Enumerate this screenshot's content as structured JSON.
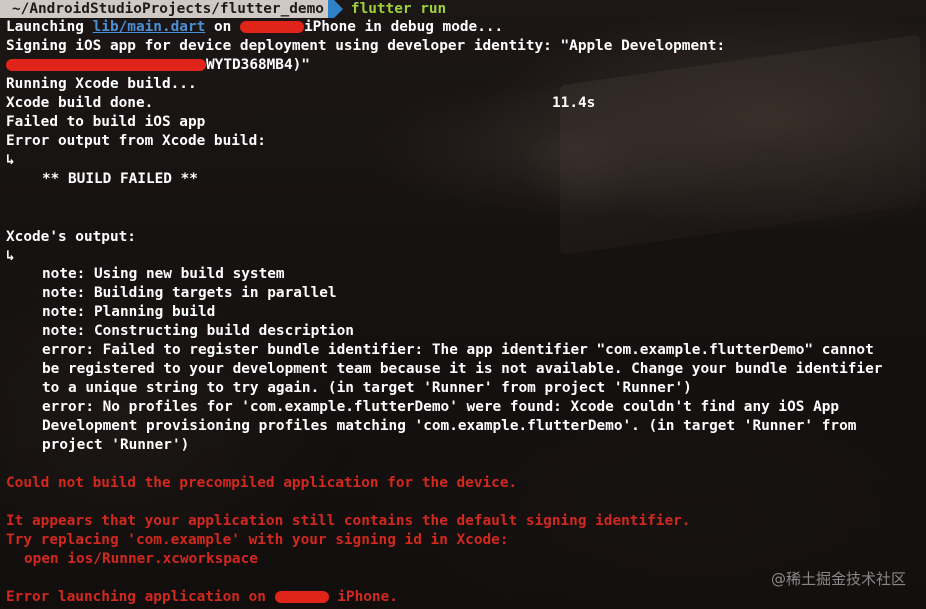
{
  "prompt": {
    "path": "~/AndroidStudioProjects/flutter_demo",
    "command": "flutter run"
  },
  "lines": {
    "launching_prefix": "Launching ",
    "launching_link": "lib/main.dart",
    "launching_on": " on ",
    "launching_suffix": "iPhone in debug mode...",
    "signing": "Signing iOS app for device deployment using developer identity: \"Apple Development:",
    "identity_suffix": "WYTD368MB4)\"",
    "running_xcode": "Running Xcode build...",
    "xcode_done": "Xcode build done.",
    "xcode_time": "11.4s",
    "failed_build": "Failed to build iOS app",
    "error_output": "Error output from Xcode build:",
    "arrow1": "↳",
    "build_failed": "** BUILD FAILED **",
    "xcode_output": "Xcode's output:",
    "arrow2": "↳",
    "note1": "note: Using new build system",
    "note2": "note: Building targets in parallel",
    "note3": "note: Planning build",
    "note4": "note: Constructing build description",
    "error1_a": "error: Failed to register bundle identifier: The app identifier \"com.example.flutterDemo\" cannot",
    "error1_b": "be registered to your development team because it is not available. Change your bundle identifier",
    "error1_c": "to a unique string to try again. (in target 'Runner' from project 'Runner')",
    "error2_a": "error: No profiles for 'com.example.flutterDemo' were found: Xcode couldn't find any iOS App",
    "error2_b": "Development provisioning profiles matching 'com.example.flutterDemo'. (in target 'Runner' from",
    "error2_c": "project 'Runner')",
    "could_not_build": "Could not build the precompiled application for the device.",
    "appears": "It appears that your application still contains the default signing identifier.",
    "try_replacing": "Try replacing 'com.example' with your signing id in Xcode:",
    "open_ws": "open ios/Runner.xcworkspace",
    "error_launching_prefix": "Error launching application on ",
    "error_launching_suffix": " iPhone."
  },
  "watermark": "@稀土掘金技术社区",
  "colors": {
    "error_red": "#d2281e",
    "prompt_green": "#9fd03a",
    "prompt_blue": "#2f82c8",
    "link_blue": "#4a8fd6",
    "redaction_red": "#e0241a"
  }
}
